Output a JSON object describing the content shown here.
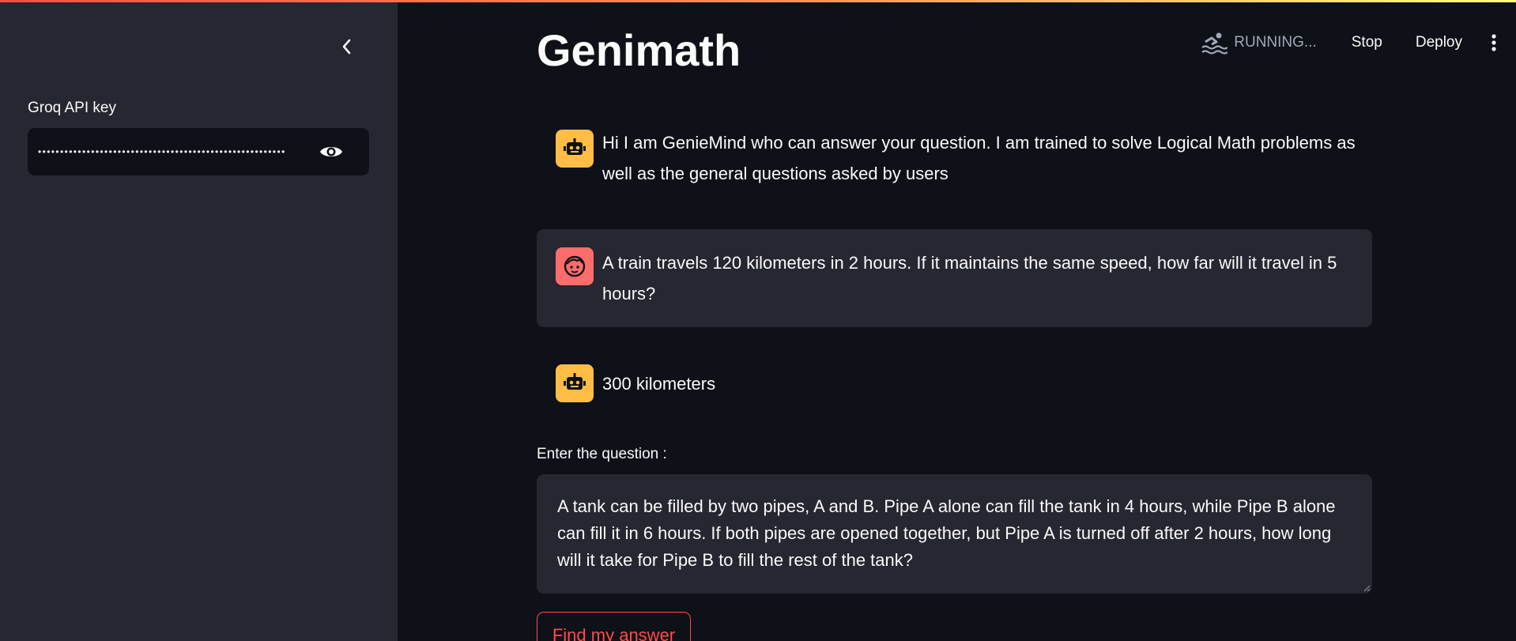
{
  "sidebar": {
    "api_key_label": "Groq API key",
    "api_key_masked": "••••••••••••••••••••••••••••••••••••••••••••••••••••••••"
  },
  "header": {
    "status": "RUNNING...",
    "stop_label": "Stop",
    "deploy_label": "Deploy"
  },
  "main": {
    "title": "Genimath",
    "messages": [
      {
        "role": "assistant",
        "text": "Hi I am GenieMind who can answer your question. I am trained to solve Logical Math problems as well as the general questions asked by users"
      },
      {
        "role": "user",
        "text": "A train travels 120 kilometers in 2 hours. If it maintains the same speed, how far will it travel in 5 hours?"
      },
      {
        "role": "assistant",
        "text": "300 kilometers"
      }
    ],
    "question_label": "Enter the question :",
    "question_value": "A tank can be filled by two pipes, A and B. Pipe A alone can fill the tank in 4 hours, while Pipe B alone can fill it in 6 hours. If both pipes are opened together, but Pipe A is turned off after 2 hours, how long will it take for Pipe B to fill the rest of the tank?",
    "submit_label": "Find my answer"
  },
  "colors": {
    "background": "#0e1117",
    "sidebar": "#262730",
    "accent": "#ff4b4b",
    "bot_avatar": "#ffbd45",
    "user_avatar": "#ff6c6c"
  },
  "icons": {
    "collapse": "chevron-left-icon",
    "visibility": "eye-icon",
    "status": "swimmer-icon",
    "menu": "vertical-dots-icon",
    "assistant": "robot-icon",
    "user": "face-icon"
  }
}
